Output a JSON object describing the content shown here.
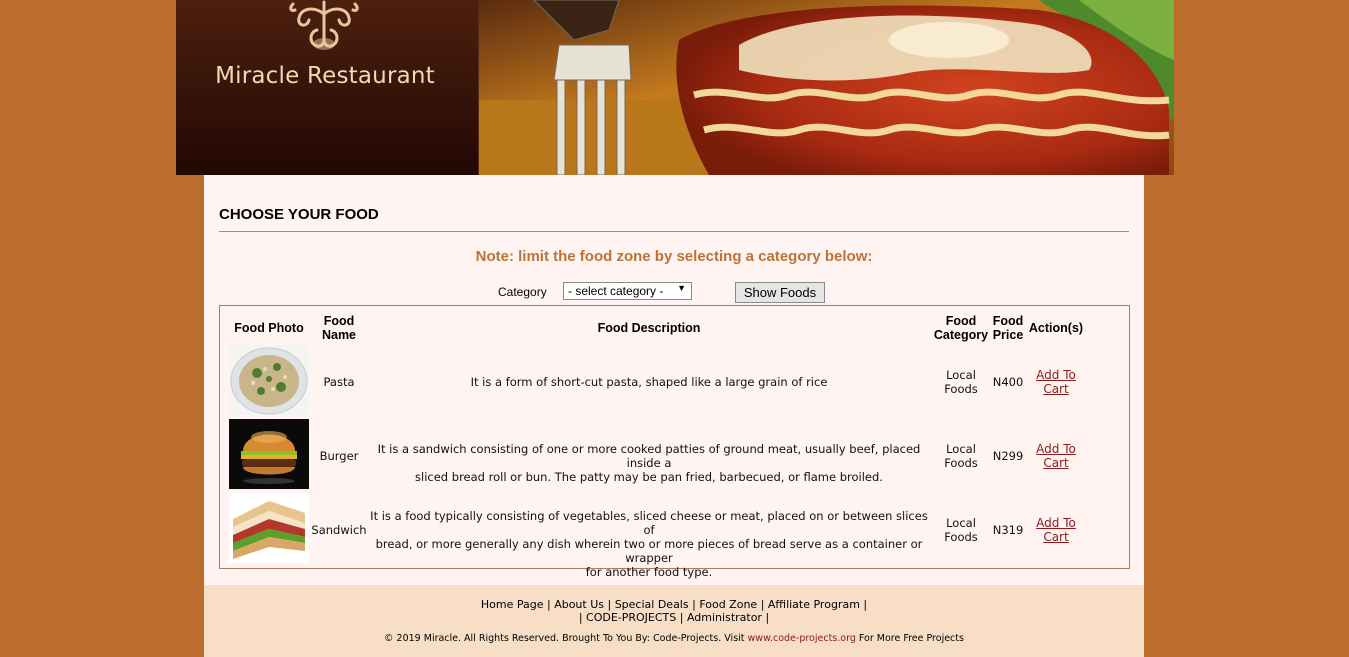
{
  "brand": {
    "name": "Miracle Restaurant"
  },
  "page": {
    "title": "CHOOSE YOUR FOOD",
    "note": "Note: limit the food zone by selecting a category below:"
  },
  "filter": {
    "category_label": "Category",
    "category_selected": "- select category -",
    "show_button": "Show Foods"
  },
  "table": {
    "headers": {
      "photo": "Food Photo",
      "name_line1": "Food",
      "name_line2": "Name",
      "description": "Food Description",
      "category_line1": "Food",
      "category_line2": "Category",
      "price_line1": "Food",
      "price_line2": "Price",
      "actions": "Action(s)"
    },
    "rows": [
      {
        "name": "Pasta",
        "description_lines": [
          "It is a form of short-cut pasta, shaped like a large grain of rice"
        ],
        "category_line1": "Local",
        "category_line2": "Foods",
        "price": "N400",
        "action_line1": "Add To",
        "action_line2": "Cart"
      },
      {
        "name": "Burger",
        "description_lines": [
          "It is a sandwich consisting of one or more cooked patties of ground meat, usually beef, placed inside a",
          "sliced bread roll or bun. The patty may be pan fried, barbecued, or flame broiled."
        ],
        "category_line1": "Local",
        "category_line2": "Foods",
        "price": "N299",
        "action_line1": "Add To",
        "action_line2": "Cart"
      },
      {
        "name": "Sandwich",
        "description_lines": [
          "It is a food typically consisting of vegetables, sliced cheese or meat, placed on or between slices of",
          "bread, or more generally any dish wherein two or more pieces of bread serve as a container or wrapper",
          "for another food type."
        ],
        "category_line1": "Local",
        "category_line2": "Foods",
        "price": "N319",
        "action_line1": "Add To",
        "action_line2": "Cart"
      }
    ]
  },
  "footer": {
    "links": [
      "Home Page",
      "About Us",
      "Special Deals",
      "Food Zone",
      "Affiliate Program"
    ],
    "links2": [
      "CODE-PROJECTS",
      "Administrator"
    ],
    "copyright_prefix": "© 2019 Miracle. All Rights Reserved. Brought To You By: Code-Projects. Visit ",
    "copyright_site": "www.code-projects.org",
    "copyright_suffix": " For More Free Projects"
  },
  "colors": {
    "page_bg": "#bc6d2d",
    "content_bg": "#fff4f1",
    "note_color": "#bc7436",
    "link_color": "#8b1a1a",
    "footer_bg": "#f8dec6"
  },
  "icons": [
    "ornament-logo-icon",
    "dropdown-arrow-icon"
  ]
}
